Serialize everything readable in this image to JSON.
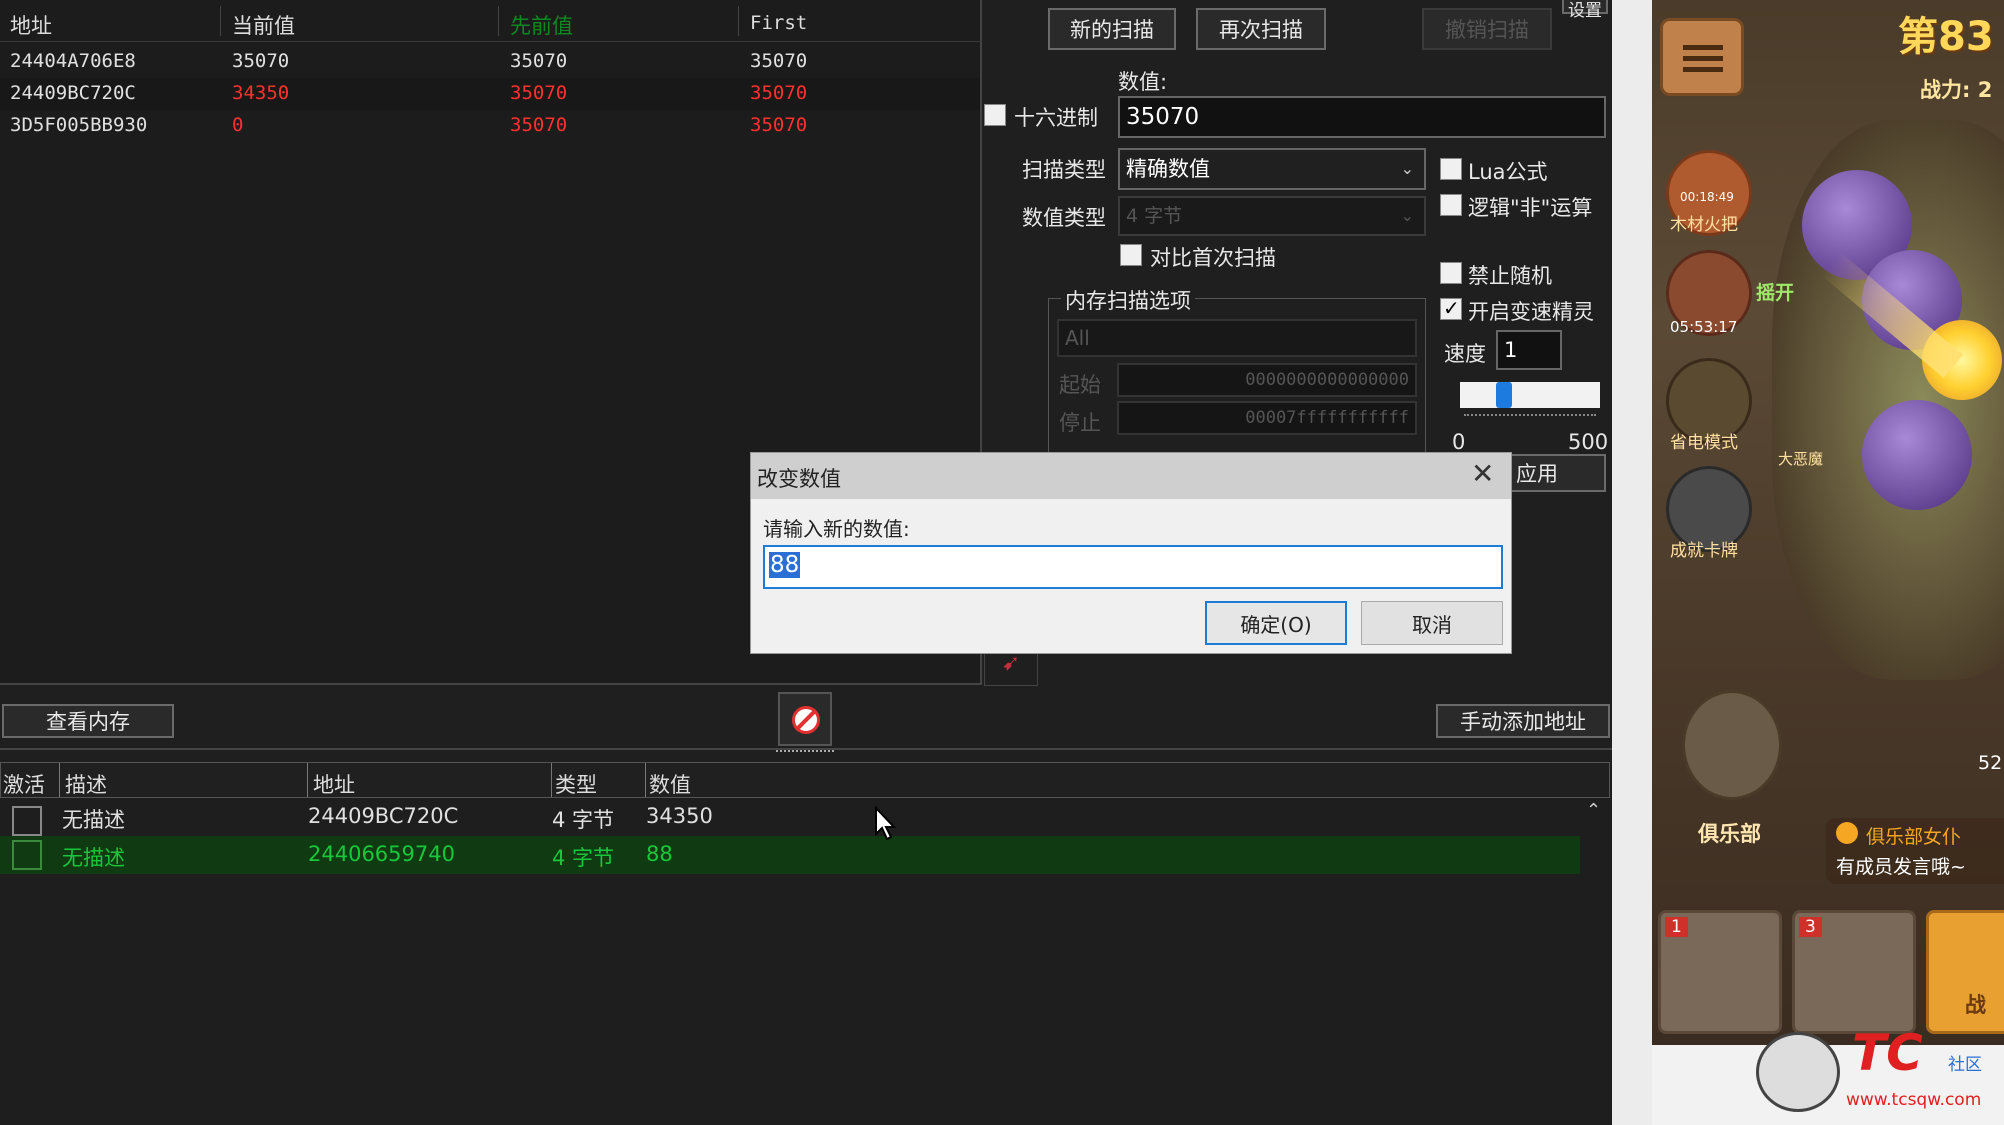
{
  "scan_results": {
    "headers": [
      "地址",
      "当前值",
      "先前值",
      "First"
    ],
    "rows": [
      {
        "address": "24404A706E8",
        "current": "35070",
        "previous": "35070",
        "first": "35070"
      },
      {
        "address": "24409BC720C",
        "current": "34350",
        "previous": "35070",
        "first": "35070"
      },
      {
        "address": "3D5F005BB930",
        "current": "0",
        "previous": "35070",
        "first": "35070"
      }
    ]
  },
  "toolbar": {
    "new_scan": "新的扫描",
    "next_scan": "再次扫描",
    "undo_scan": "撤销扫描",
    "settings": "设置"
  },
  "value": {
    "label": "数值:",
    "hex_label": "十六进制",
    "input": "35070"
  },
  "scan_type": {
    "label": "扫描类型",
    "value": "精确数值"
  },
  "value_type": {
    "label": "数值类型",
    "value": "4 字节"
  },
  "compare_first": "对比首次扫描",
  "options": {
    "lua": "Lua公式",
    "logic_not": "逻辑\"非\"运算",
    "no_random": "禁止随机",
    "speedhack": "开启变速精灵",
    "speed_label": "速度",
    "speed_value": "1",
    "slider_min": "0",
    "slider_max": "500",
    "apply": "应用"
  },
  "memory": {
    "title": "内存扫描选项",
    "region": "All",
    "start_label": "起始",
    "start_value": "0000000000000000",
    "stop_label": "停止",
    "stop_value": "00007fffffffffff"
  },
  "view_memory": "查看内存",
  "add_address": "手动添加地址",
  "address_list": {
    "headers": [
      "激活",
      "描述",
      "地址",
      "类型",
      "数值"
    ],
    "rows": [
      {
        "desc": "无描述",
        "address": "24409BC720C",
        "type": "4 字节",
        "value": "34350"
      },
      {
        "desc": "无描述",
        "address": "24406659740",
        "type": "4 字节",
        "value": "88"
      }
    ]
  },
  "dialog": {
    "title": "改变数值",
    "prompt": "请输入新的数值:",
    "input": "88",
    "ok": "确定(O)",
    "cancel": "取消"
  },
  "game": {
    "level": "第83",
    "power": "战力: 2",
    "timer1": "00:18:49",
    "label1": "木材火把",
    "timer2": "05:53:17",
    "label2": "摇开",
    "label3": "省电模式",
    "label4": "成就卡牌",
    "label5": "大恶魔",
    "club": "俱乐部",
    "chat1": "俱乐部女仆",
    "chat2": "有成员发言哦~",
    "badge1": "1",
    "badge2": "3",
    "count": "52",
    "tab": "战"
  },
  "watermark": {
    "text": "TC",
    "sub": "社区",
    "url": "www.tcsqw.com"
  },
  "colors": {
    "green": "#19c83a",
    "red": "#ff3030",
    "selected_row": "#0f3a12"
  }
}
